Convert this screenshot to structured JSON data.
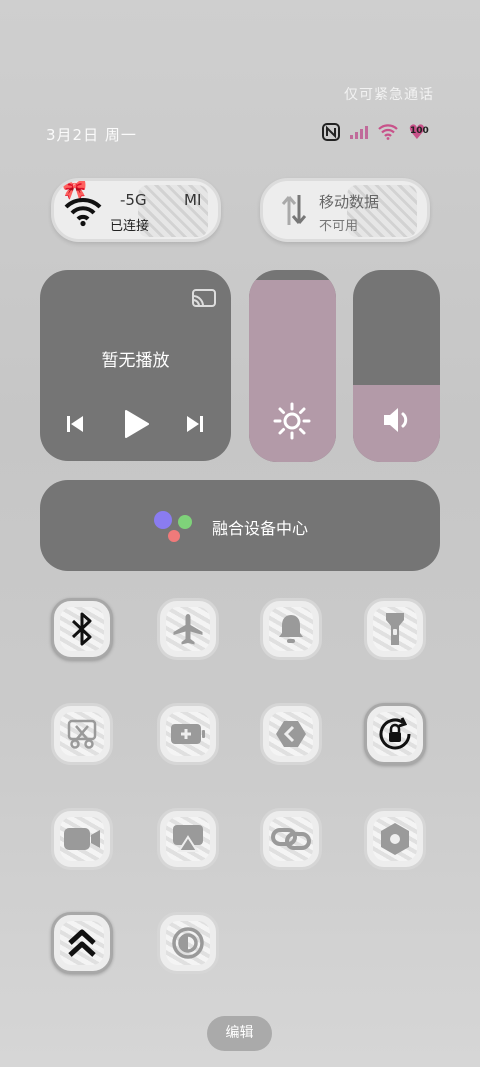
{
  "status_bar": {
    "emergency_text": "仅可紧急通话",
    "date_text": "3月2日 周一",
    "battery_level": "100"
  },
  "wifi_pill": {
    "name": "-5G",
    "extra": "MI",
    "status": "已连接"
  },
  "data_pill": {
    "name": "移动数据",
    "status": "不可用"
  },
  "media": {
    "title": "暂无播放"
  },
  "brightness": {
    "level": 0.95
  },
  "volume": {
    "level": 0.4
  },
  "fusion": {
    "label": "融合设备中心"
  },
  "toggles": [
    {
      "name": "bluetooth",
      "active": true
    },
    {
      "name": "airplane",
      "active": false
    },
    {
      "name": "bell",
      "active": false
    },
    {
      "name": "flashlight",
      "active": false
    },
    {
      "name": "screenshot",
      "active": false
    },
    {
      "name": "battery-saver",
      "active": false
    },
    {
      "name": "mi-share",
      "active": false
    },
    {
      "name": "rotation-lock",
      "active": true
    },
    {
      "name": "screen-recorder",
      "active": false
    },
    {
      "name": "cast",
      "active": false
    },
    {
      "name": "link",
      "active": false
    },
    {
      "name": "settings-hex",
      "active": false
    },
    {
      "name": "performance",
      "active": true
    },
    {
      "name": "dark-mode",
      "active": false
    }
  ],
  "edit_button": {
    "label": "编辑"
  },
  "colors": {
    "accent_pink": "#b39aa8",
    "tile_gray": "#757575",
    "assistant_blue": "#8a7cf0",
    "assistant_green": "#7fd27a",
    "assistant_red": "#f07a7a"
  }
}
